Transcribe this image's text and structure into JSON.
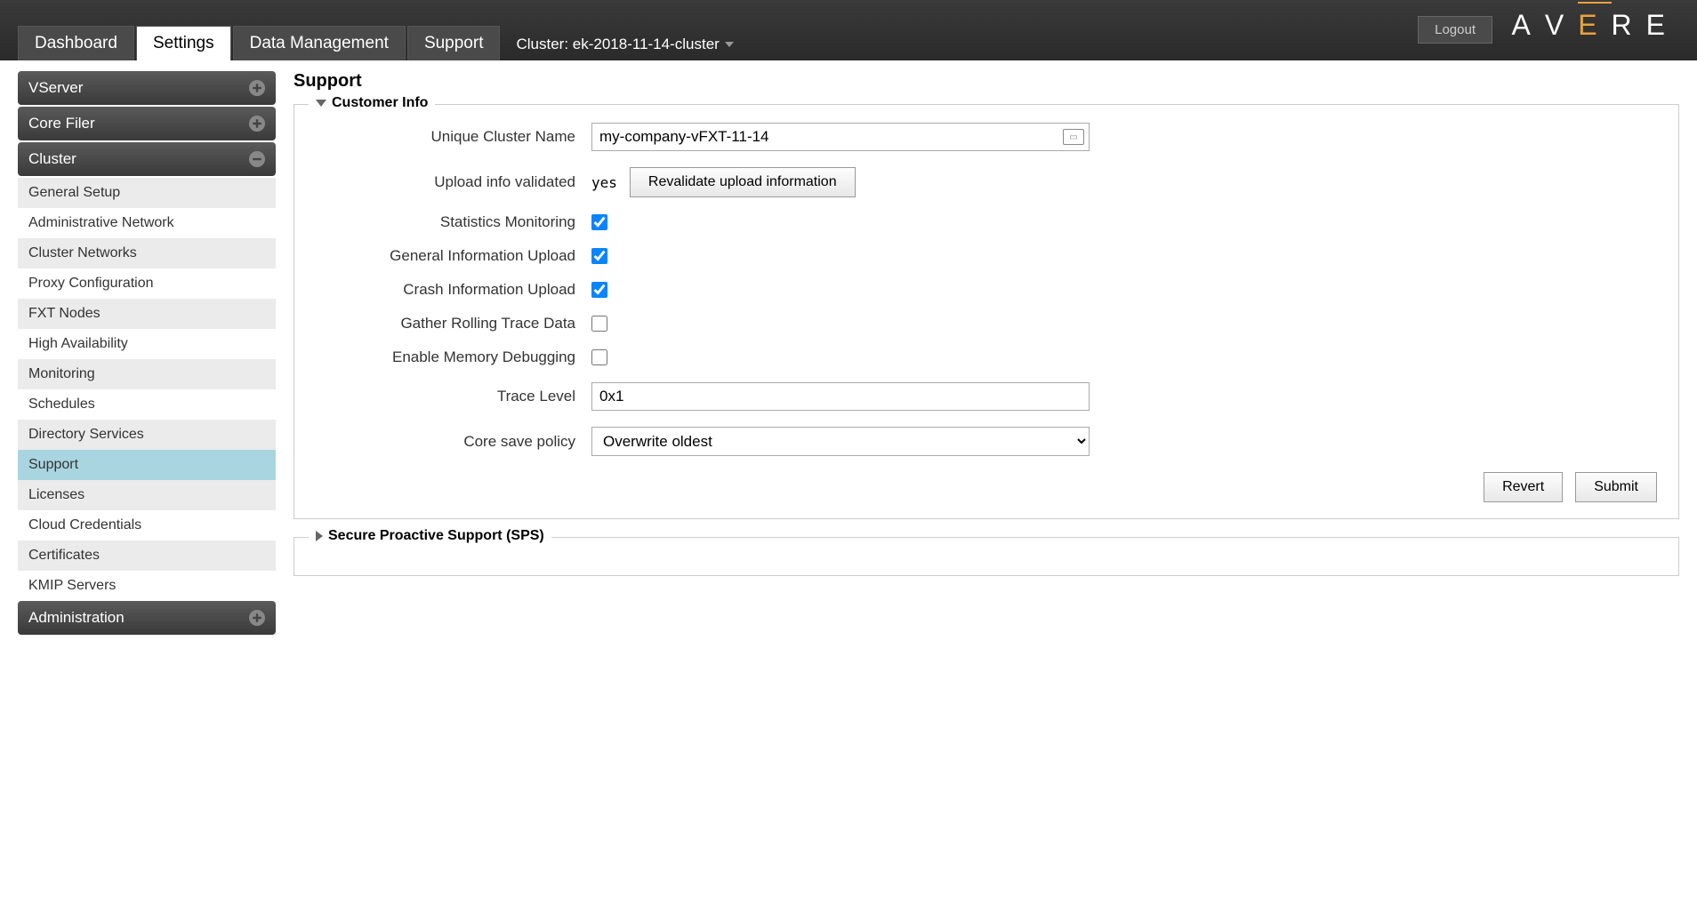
{
  "header": {
    "logout_label": "Logout",
    "logo_letters": [
      "A",
      "V",
      "E",
      "R",
      "E"
    ],
    "tabs": [
      {
        "label": "Dashboard",
        "active": false
      },
      {
        "label": "Settings",
        "active": true
      },
      {
        "label": "Data Management",
        "active": false
      },
      {
        "label": "Support",
        "active": false
      }
    ],
    "cluster_label": "Cluster: ek-2018-11-14-cluster"
  },
  "sidebar": {
    "sections": [
      {
        "label": "VServer",
        "expanded": false,
        "items": []
      },
      {
        "label": "Core Filer",
        "expanded": false,
        "items": []
      },
      {
        "label": "Cluster",
        "expanded": true,
        "items": [
          {
            "label": "General Setup"
          },
          {
            "label": "Administrative Network"
          },
          {
            "label": "Cluster Networks"
          },
          {
            "label": "Proxy Configuration"
          },
          {
            "label": "FXT Nodes"
          },
          {
            "label": "High Availability"
          },
          {
            "label": "Monitoring"
          },
          {
            "label": "Schedules"
          },
          {
            "label": "Directory Services"
          },
          {
            "label": "Support",
            "selected": true
          },
          {
            "label": "Licenses"
          },
          {
            "label": "Cloud Credentials"
          },
          {
            "label": "Certificates"
          },
          {
            "label": "KMIP Servers"
          }
        ]
      },
      {
        "label": "Administration",
        "expanded": false,
        "items": []
      }
    ]
  },
  "page": {
    "title": "Support",
    "customer_info": {
      "legend": "Customer Info",
      "unique_cluster_name_label": "Unique Cluster Name",
      "unique_cluster_name_value": "my-company-vFXT-11-14",
      "upload_info_validated_label": "Upload info validated",
      "upload_info_validated_value": "yes",
      "revalidate_button": "Revalidate upload information",
      "statistics_monitoring_label": "Statistics Monitoring",
      "statistics_monitoring_checked": true,
      "general_info_upload_label": "General Information Upload",
      "general_info_upload_checked": true,
      "crash_info_upload_label": "Crash Information Upload",
      "crash_info_upload_checked": true,
      "gather_rolling_trace_label": "Gather Rolling Trace Data",
      "gather_rolling_trace_checked": false,
      "enable_memory_debugging_label": "Enable Memory Debugging",
      "enable_memory_debugging_checked": false,
      "trace_level_label": "Trace Level",
      "trace_level_value": "0x1",
      "core_save_policy_label": "Core save policy",
      "core_save_policy_value": "Overwrite oldest",
      "revert_button": "Revert",
      "submit_button": "Submit"
    },
    "sps": {
      "legend": "Secure Proactive Support (SPS)"
    }
  }
}
